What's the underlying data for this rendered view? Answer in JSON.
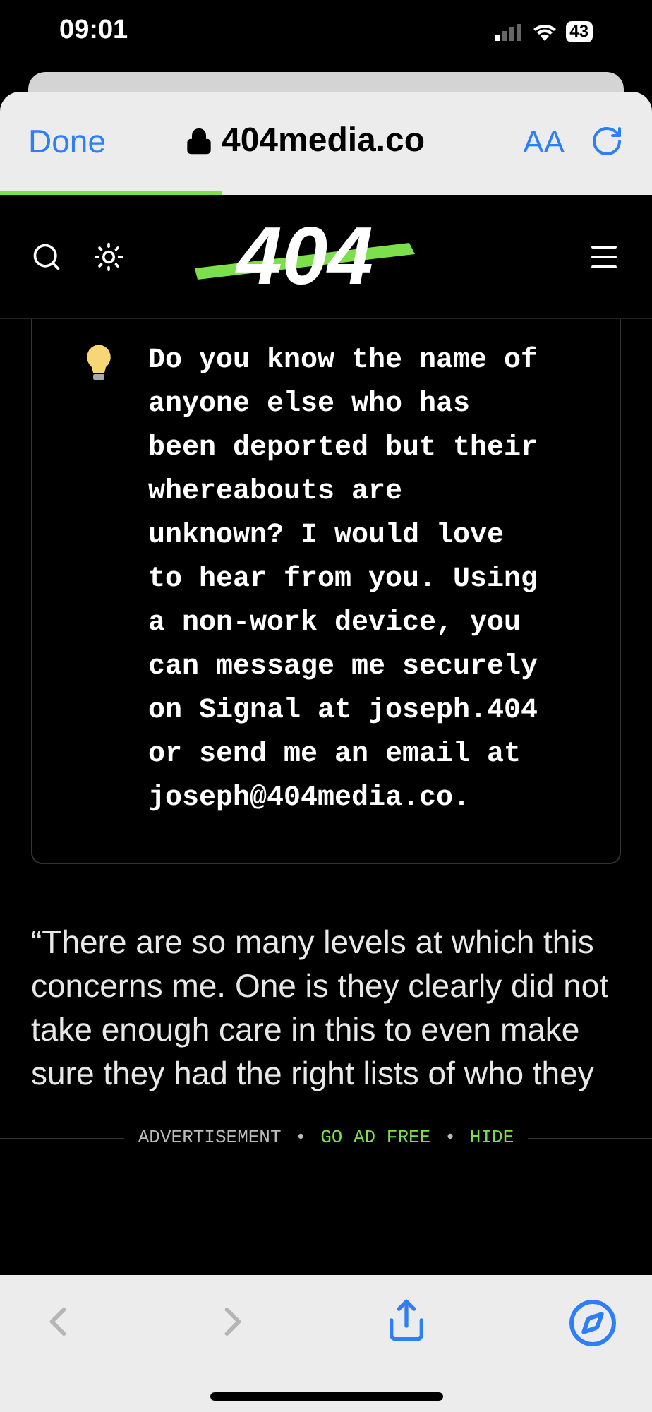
{
  "status_bar": {
    "time": "09:01",
    "battery": "43"
  },
  "browser": {
    "done": "Done",
    "url": "404media.co",
    "text_size": "AA",
    "progress": {
      "level": 0.34
    }
  },
  "site_header": {
    "logo": "404"
  },
  "callout": {
    "text": "Do you know the name of anyone else who has been deported but their whereabouts are unknown? I would love to hear from you. Using a non-work device, you can message me securely on Signal at joseph.404 or send me an email at joseph@404media.co."
  },
  "article": {
    "paragraph": "“There are so many levels at which this concerns me. One is they clearly did not take enough care in this to even make sure they had the right lists of who they"
  },
  "ad_bar": {
    "label": "ADVERTISEMENT",
    "links": [
      "GO AD FREE",
      "HIDE"
    ],
    "separator": "•"
  },
  "toolbar": {
    "back_disabled": true,
    "forward_disabled": true
  }
}
